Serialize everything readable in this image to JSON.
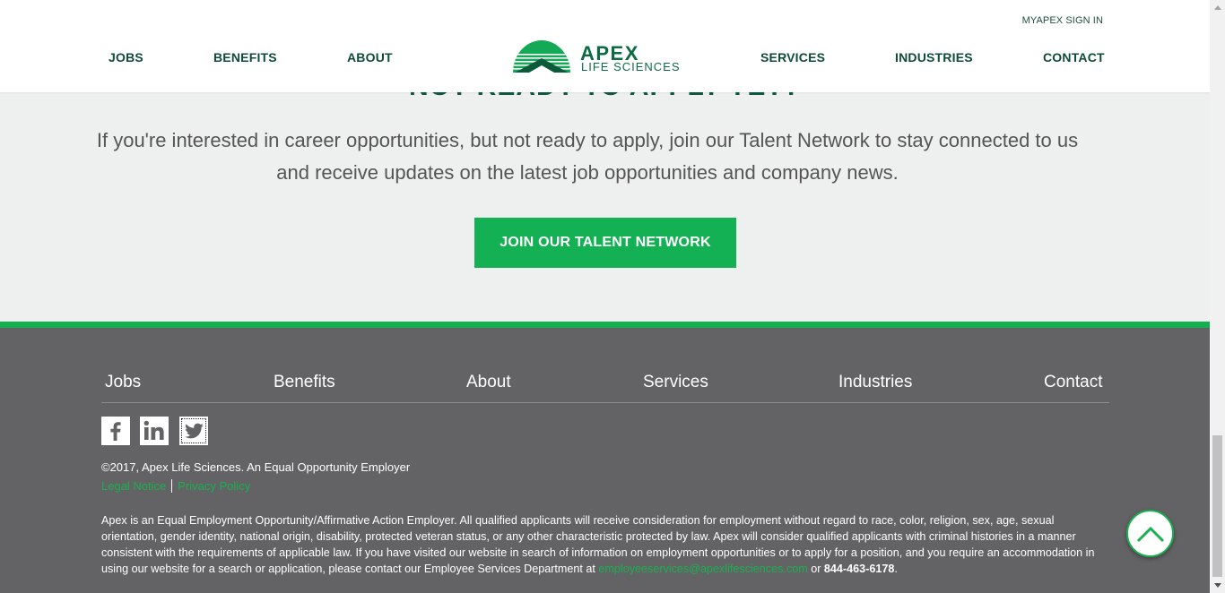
{
  "header": {
    "sign_in": "MYAPEX SIGN IN",
    "nav_left": [
      "JOBS",
      "BENEFITS",
      "ABOUT"
    ],
    "nav_right": [
      "SERVICES",
      "INDUSTRIES",
      "CONTACT"
    ],
    "logo": {
      "line1": "APEX",
      "line2": "LIFE SCIENCES"
    }
  },
  "talent": {
    "heading": "NOT READY TO APPLY YET?",
    "text": "If you're interested in career opportunities, but not ready to apply, join our Talent Network to stay connected to us and receive updates on the latest job opportunities and company news.",
    "button": "JOIN OUR TALENT NETWORK"
  },
  "footer": {
    "nav": [
      "Jobs",
      "Benefits",
      "About",
      "Services",
      "Industries",
      "Contact"
    ],
    "social": [
      "facebook-icon",
      "linkedin-icon",
      "twitter-icon"
    ],
    "copyright": "©2017, Apex Life Sciences. An Equal Opportunity Employer",
    "legal_notice": "Legal Notice",
    "privacy_policy": "Privacy Policy",
    "disclaimer_text": "Apex is an Equal Employment Opportunity/Affirmative Action Employer. All qualified applicants will receive consideration for employment without regard to race, color, religion, sex, age, sexual orientation, gender identity, national origin, disability, protected veteran status, or any other characteristic protected by law. Apex will consider qualified applicants with criminal histories in a manner consistent with the requirements of applicable law. If you have visited our website in search of information on employment opportunities or to apply for a position, and you require an accommodation in using our website for a search or application, please contact our Employee Services Department at",
    "email": "employeeservices@apexlifesciences.com",
    "or": "or",
    "phone": "844-463-6178",
    "period": "."
  },
  "colors": {
    "brand_green": "#13b153",
    "dark_green": "#0f4c37",
    "footer_bg": "#636365",
    "section_bg": "#eef0ef"
  },
  "icons": {
    "back_to_top": "chevron-up-icon"
  }
}
